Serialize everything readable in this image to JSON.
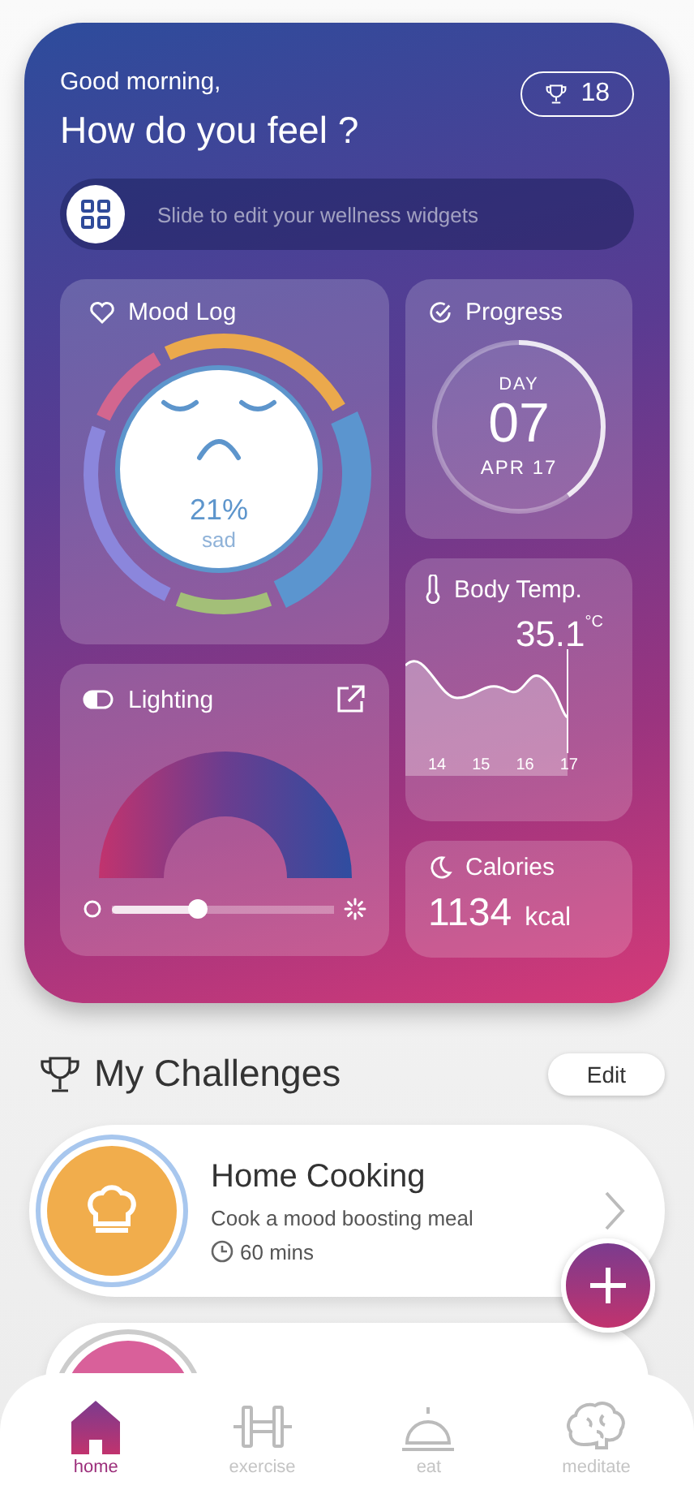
{
  "header": {
    "greeting": "Good morning,",
    "title": "How do you feel ?",
    "trophies": "18"
  },
  "widget_slider": {
    "hint": "Slide to edit your wellness widgets",
    "level": 0
  },
  "mood_log": {
    "title": "Mood Log",
    "percent": "21%",
    "mood": "sad",
    "segments": [
      {
        "color": "#d2668f"
      },
      {
        "color": "#eba94c"
      },
      {
        "color": "#5b95cf"
      },
      {
        "color": "#a3bf78"
      },
      {
        "color": "#8b86dc"
      }
    ]
  },
  "progress": {
    "title": "Progress",
    "label": "DAY",
    "day": "07",
    "date": "APR 17",
    "level": 0.4
  },
  "body_temp": {
    "title": "Body Temp.",
    "value": "35.1",
    "unit": "°C",
    "x_labels": [
      "14",
      "15",
      "16",
      "17"
    ]
  },
  "lighting": {
    "title": "Lighting",
    "level": 0.39
  },
  "calories": {
    "title": "Calories",
    "value": "1134",
    "unit": "kcal"
  },
  "challenges": {
    "title": "My Challenges",
    "edit": "Edit",
    "items": [
      {
        "title": "Home Cooking",
        "description": "Cook a mood boosting meal",
        "duration": "60 mins",
        "color": "#f1ad4c"
      },
      {
        "color": "#d9609a"
      }
    ]
  },
  "nav": [
    {
      "label": "home",
      "selected": true
    },
    {
      "label": "exercise",
      "selected": false
    },
    {
      "label": "eat",
      "selected": false
    },
    {
      "label": "meditate",
      "selected": false
    }
  ]
}
